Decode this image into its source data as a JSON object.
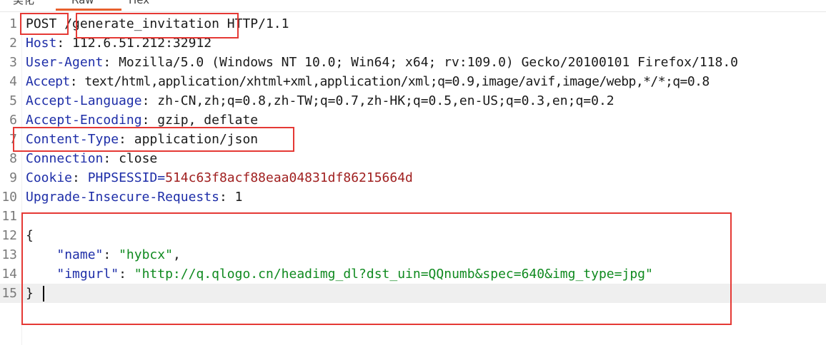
{
  "tabs": [
    {
      "label": "美化"
    },
    {
      "label": "Raw",
      "active": true
    },
    {
      "label": "Hex"
    }
  ],
  "request": {
    "lines": [
      {
        "num": "1",
        "method": "POST",
        "path": "/generate_invitation",
        "version": " HTTP/1.1"
      },
      {
        "num": "2",
        "key": "Host",
        "value": "112.6.51.212:32912"
      },
      {
        "num": "3",
        "key": "User-Agent",
        "value": "Mozilla/5.0 (Windows NT 10.0; Win64; x64; rv:109.0) Gecko/20100101 Firefox/118.0"
      },
      {
        "num": "4",
        "key": "Accept",
        "value": "text/html,application/xhtml+xml,application/xml;q=0.9,image/avif,image/webp,*/*;q=0.8"
      },
      {
        "num": "5",
        "key": "Accept-Language",
        "value": "zh-CN,zh;q=0.8,zh-TW;q=0.7,zh-HK;q=0.5,en-US;q=0.3,en;q=0.2"
      },
      {
        "num": "6",
        "key": "Accept-Encoding",
        "value": "gzip, deflate"
      },
      {
        "num": "7",
        "key": "Content-Type",
        "value": "application/json"
      },
      {
        "num": "8",
        "key": "Connection",
        "value": "close"
      },
      {
        "num": "9",
        "key": "Cookie",
        "cookie_name": "PHPSESSID",
        "cookie_value": "514c63f8acf88eaa04831df86215664d"
      },
      {
        "num": "10",
        "key": "Upgrade-Insecure-Requests",
        "value": "1"
      },
      {
        "num": "11"
      },
      {
        "num": "12",
        "text": "{"
      },
      {
        "num": "13",
        "json_key": "\"name\"",
        "json_value": "\"hybcx\"",
        "trail": ","
      },
      {
        "num": "14",
        "json_key": "\"imgurl\"",
        "json_value": "\"http://q.qlogo.cn/headimg_dl?dst_uin=QQnumb&spec=640&img_type=jpg\""
      },
      {
        "num": "15",
        "text": "}"
      }
    ]
  },
  "colors": {
    "header_key": "#1e2ea8",
    "cookie_value": "#a02020",
    "json_string": "#0f8a1f",
    "highlight_box": "#e53935",
    "active_tab_underline": "#e8602c"
  }
}
